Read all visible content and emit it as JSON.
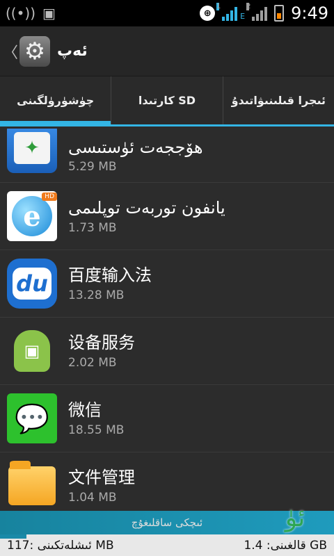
{
  "status_bar": {
    "time": "9:49",
    "sim1_label": "1",
    "sim1_type": "E",
    "sim2_label": "2",
    "icons": [
      "wifi-hotspot-icon",
      "image-icon",
      "globe-icon",
      "signal-icon",
      "battery-icon"
    ]
  },
  "action_bar": {
    "title": "ئەپ",
    "icon": "gear-icon"
  },
  "tabs": [
    {
      "label": "چۈشۈرۈلگىنى",
      "active": true
    },
    {
      "label": "كارتىدا SD",
      "active": false
    },
    {
      "label": "ئىجرا قىلىنىۋاتىدۇ",
      "active": false
    }
  ],
  "apps": [
    {
      "name": "ھۆججەت ئۈستىسى",
      "size": "5.29 MB",
      "icon": "magic-wand-icon"
    },
    {
      "name": "يانفون توربەت توپلىمى",
      "size": "1.73 MB",
      "icon": "browser-e-icon"
    },
    {
      "name": "百度输入法",
      "size": "13.28 MB",
      "icon": "baidu-du-icon"
    },
    {
      "name": "设备服务",
      "size": "2.02 MB",
      "icon": "android-robot-icon"
    },
    {
      "name": "微信",
      "size": "18.55 MB",
      "icon": "wechat-icon"
    },
    {
      "name": "文件管理",
      "size": "1.04 MB",
      "icon": "folder-icon"
    }
  ],
  "storage": {
    "label": "ئىچكى ساقلىغۇچ",
    "free": "ئىشلەتكىنى  :117 MB",
    "used": "قالغىنى:  1.4 GB",
    "used_fraction": 0.08
  },
  "colors": {
    "accent": "#33b5e5",
    "background": "#2c2c2c",
    "storage_band": "#1a8aa8"
  }
}
